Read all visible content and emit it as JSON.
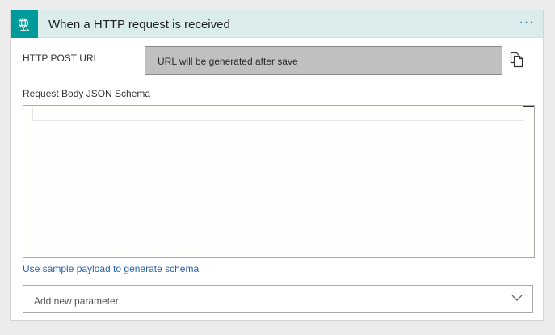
{
  "header": {
    "title": "When a HTTP request is received",
    "more_label": "···",
    "icon": "globe-request-icon",
    "accent_color": "#009a9a",
    "background_color": "#dbeced"
  },
  "post_url": {
    "label": "HTTP POST URL",
    "value": "URL will be generated after save",
    "copy_icon": "copy-icon"
  },
  "schema": {
    "label": "Request Body JSON Schema",
    "content": ""
  },
  "sample_link": {
    "label": "Use sample payload to generate schema",
    "color": "#2762b0"
  },
  "parameter": {
    "placeholder": "Add new parameter",
    "chevron_icon": "chevron-down-icon"
  }
}
